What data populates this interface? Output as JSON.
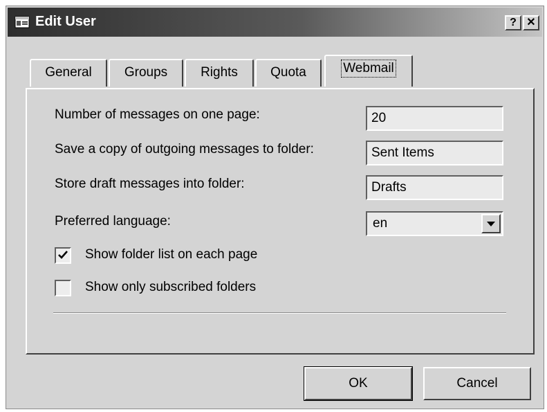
{
  "window": {
    "title": "Edit User",
    "title_icon": "user-card-icon",
    "help_label": "?",
    "close_label": "✕"
  },
  "tabs": [
    {
      "label": "General"
    },
    {
      "label": "Groups"
    },
    {
      "label": "Rights"
    },
    {
      "label": "Quota"
    },
    {
      "label": "Webmail",
      "active": true
    }
  ],
  "webmail": {
    "messages_per_page_label": "Number of messages on one page:",
    "messages_per_page_value": "20",
    "sent_folder_label": "Save a copy of outgoing messages to folder:",
    "sent_folder_value": "Sent Items",
    "drafts_folder_label": "Store draft messages into folder:",
    "drafts_folder_value": "Drafts",
    "language_label": "Preferred language:",
    "language_value": "en",
    "show_folder_list_label": "Show folder list on each page",
    "show_folder_list_checked": true,
    "show_subscribed_label": "Show only subscribed folders",
    "show_subscribed_checked": false
  },
  "buttons": {
    "ok": "OK",
    "cancel": "Cancel"
  }
}
